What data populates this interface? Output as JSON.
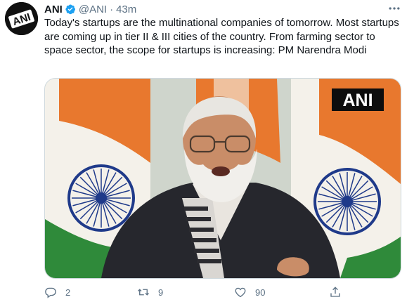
{
  "author": {
    "name": "ANI",
    "handle": "@ANI",
    "time": "43m",
    "verified_color": "#1da1f2",
    "avatar_logo_text": "ANI"
  },
  "tweet": {
    "text": "Today's startups are the multinational companies of tomorrow. Most startups are coming up in tier II & III cities of the country. From farming sector to space sector, the scope for startups is increasing: PM Narendra Modi"
  },
  "media": {
    "watermark": "ANI",
    "flag_colors": {
      "saffron": "#e8782e",
      "white": "#f4f1ea",
      "green": "#2f8a3a",
      "chakra": "#1f3a8a"
    }
  },
  "actions": {
    "reply_count": "2",
    "retweet_count": "9",
    "like_count": "90",
    "icons": [
      "reply-icon",
      "retweet-icon",
      "like-icon",
      "share-icon"
    ]
  },
  "colors": {
    "text": "#0f1419",
    "secondary": "#5b7083",
    "accent": "#1da1f2"
  }
}
